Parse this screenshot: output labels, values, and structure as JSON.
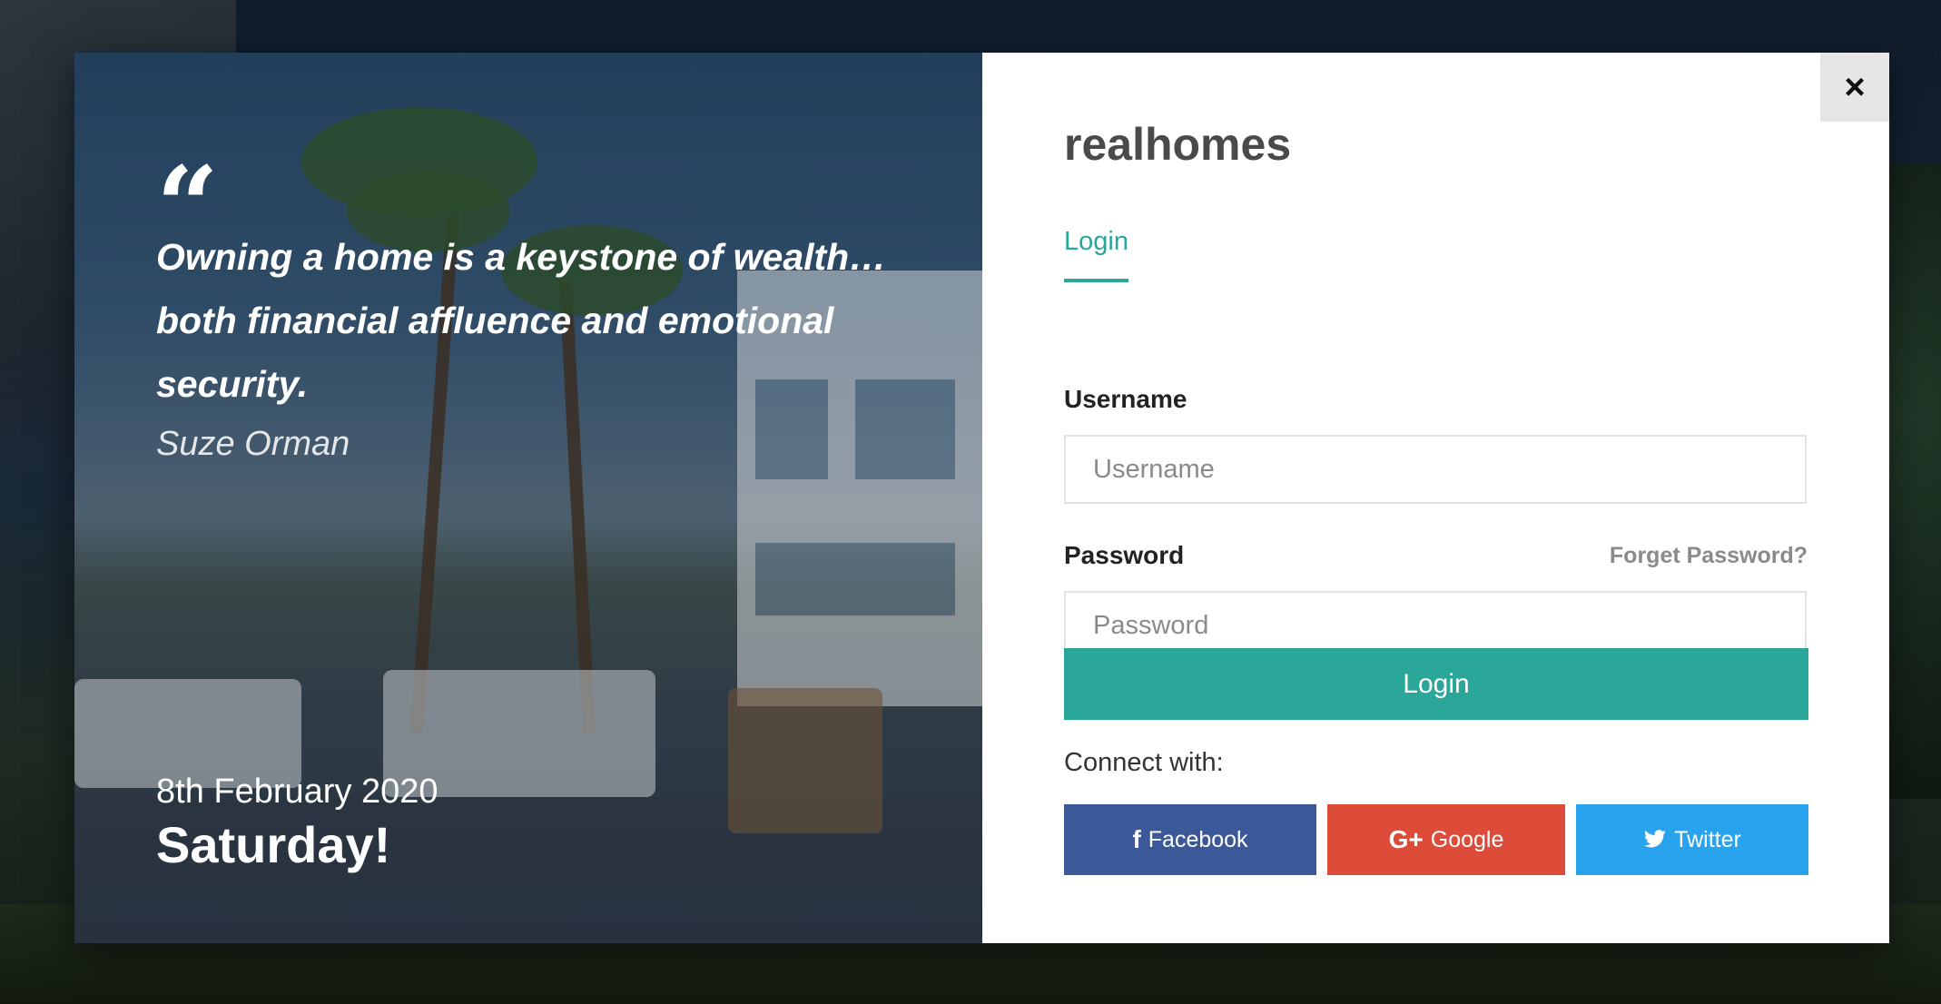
{
  "quote": {
    "mark": "“",
    "text": "Owning a home is a keystone of wealth… both financial affluence and emotional security.",
    "author": "Suze Orman"
  },
  "date": {
    "full": "8th February 2020",
    "day": "Saturday!"
  },
  "brand": "realhomes",
  "tabs": [
    {
      "label": "Login",
      "active": true
    }
  ],
  "form": {
    "username_label": "Username",
    "username_placeholder": "Username",
    "password_label": "Password",
    "password_placeholder": "Password",
    "forget_link": "Forget Password?",
    "submit_label": "Login"
  },
  "social": {
    "connect_label": "Connect with:",
    "facebook": "Facebook",
    "google": "Google",
    "twitter": "Twitter"
  },
  "close": "×",
  "colors": {
    "accent": "#2aa799",
    "facebook": "#3b5999",
    "google": "#dd4b39",
    "twitter": "#2aa3ef"
  }
}
